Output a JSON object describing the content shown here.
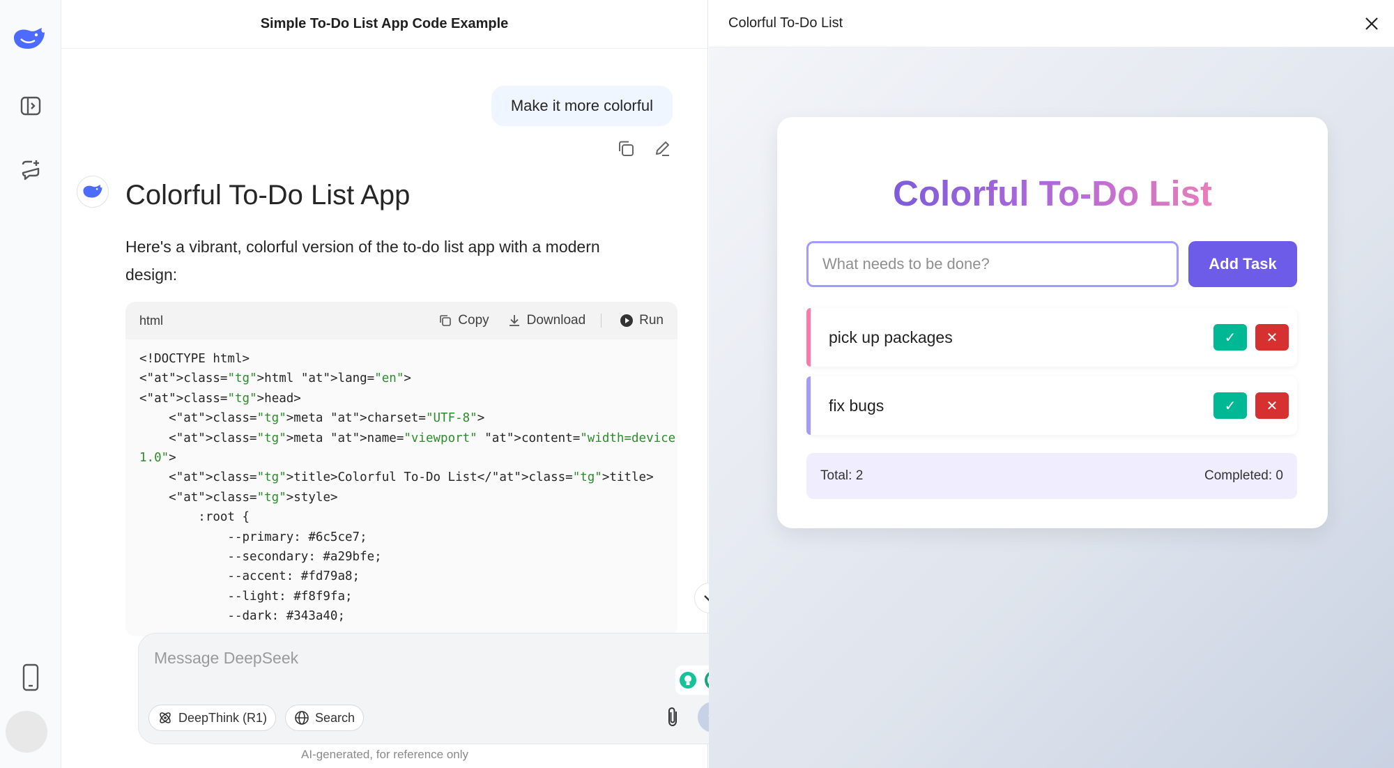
{
  "chat": {
    "title": "Simple To-Do List App Code Example",
    "user_message": "Make it more colorful",
    "answer_title": "Colorful To-Do List App",
    "answer_text": "Here's a vibrant, colorful version of the to-do list app with a modern design:",
    "code": {
      "language": "html",
      "copy_label": "Copy",
      "download_label": "Download",
      "run_label": "Run",
      "lines": [
        "<!DOCTYPE html>",
        "<html lang=\"en\">",
        "<head>",
        "    <meta charset=\"UTF-8\">",
        "    <meta name=\"viewport\" content=\"width=device-width, initial-scale=",
        "1.0\">",
        "    <title>Colorful To-Do List</title>",
        "    <style>",
        "        :root {",
        "            --primary: #6c5ce7;",
        "            --secondary: #a29bfe;",
        "            --accent: #fd79a8;",
        "            --light: #f8f9fa;",
        "            --dark: #343a40;"
      ]
    },
    "composer": {
      "placeholder": "Message DeepSeek",
      "deepthink_label": "DeepThink (R1)",
      "search_label": "Search"
    },
    "disclaimer": "AI-generated, for reference only"
  },
  "preview": {
    "title": "Colorful To-Do List",
    "app": {
      "heading": "Colorful To-Do List",
      "input_placeholder": "What needs to be done?",
      "add_label": "Add Task",
      "tasks": [
        {
          "text": "pick up packages",
          "bar_color": "#fd79a8"
        },
        {
          "text": "fix bugs",
          "bar_color": "#a29bfe"
        }
      ],
      "done_symbol": "✓",
      "delete_symbol": "✕",
      "total": "Total: 2",
      "completed": "Completed: 0"
    }
  },
  "colors": {
    "primary": "#6c5ce7",
    "secondary": "#a29bfe",
    "accent": "#fd79a8",
    "done": "#00b894",
    "delete": "#d63031",
    "brand_blue": "#4d6bfe"
  }
}
